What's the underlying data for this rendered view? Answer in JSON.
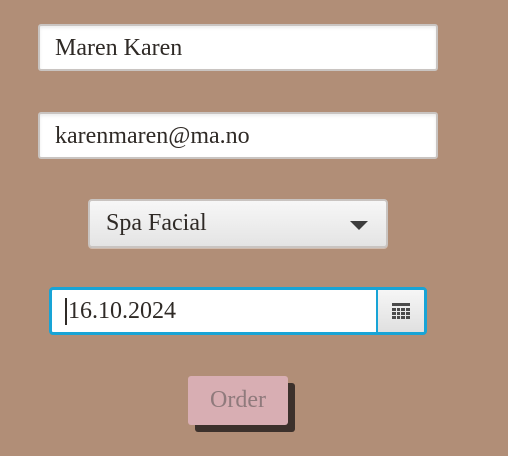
{
  "form": {
    "name_value": "Maren Karen",
    "email_value": "karenmaren@ma.no",
    "service_selected": "Spa Facial",
    "date_value": "16.10.2024",
    "calendar_icon": "calendar-icon",
    "dropdown_icon": "chevron-down-icon",
    "order_label": "Order"
  },
  "colors": {
    "background": "#b18e77",
    "focus_border": "#18a4d6",
    "order_button": "#d8aeb3",
    "order_text": "#8f7a7c"
  }
}
